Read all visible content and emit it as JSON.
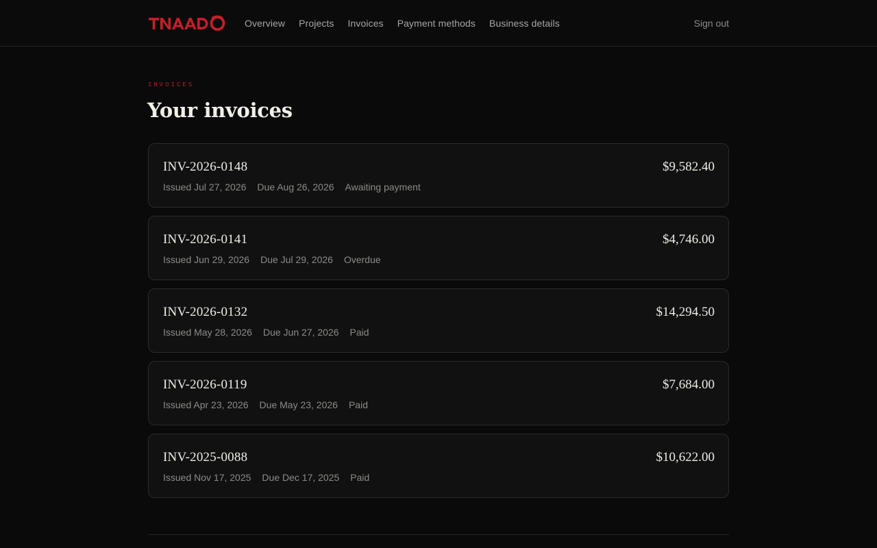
{
  "brand": {
    "logo_text": "TNAADO",
    "accent_color": "#c41e2a"
  },
  "nav": {
    "items": [
      {
        "label": "Overview"
      },
      {
        "label": "Projects"
      },
      {
        "label": "Invoices"
      },
      {
        "label": "Payment methods"
      },
      {
        "label": "Business details"
      }
    ],
    "sign_out": "Sign out"
  },
  "page": {
    "eyebrow": "INVOICES",
    "title": "Your invoices"
  },
  "invoices": [
    {
      "number": "INV-2026-0148",
      "amount": "$9,582.40",
      "issued": "Issued Jul 27, 2026",
      "due": "Due Aug 26, 2026",
      "status": "Awaiting payment"
    },
    {
      "number": "INV-2026-0141",
      "amount": "$4,746.00",
      "issued": "Issued Jun 29, 2026",
      "due": "Due Jul 29, 2026",
      "status": "Overdue"
    },
    {
      "number": "INV-2026-0132",
      "amount": "$14,294.50",
      "issued": "Issued May 28, 2026",
      "due": "Due Jun 27, 2026",
      "status": "Paid"
    },
    {
      "number": "INV-2026-0119",
      "amount": "$7,684.00",
      "issued": "Issued Apr 23, 2026",
      "due": "Due May 23, 2026",
      "status": "Paid"
    },
    {
      "number": "INV-2025-0088",
      "amount": "$10,622.00",
      "issued": "Issued Nov 17, 2025",
      "due": "Due Dec 17, 2025",
      "status": "Paid"
    }
  ]
}
